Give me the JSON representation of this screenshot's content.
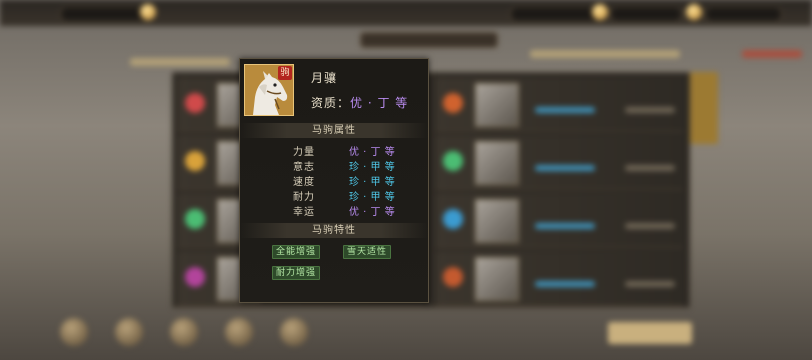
{
  "horse": {
    "badge": "驹",
    "name": "月骧",
    "aptitude_label": "资质：",
    "aptitude_value": "优 · 丁 等"
  },
  "sections": {
    "attributes_title": "马驹属性",
    "traits_title": "马驹特性"
  },
  "attributes": [
    {
      "name": "力量",
      "value": "优 · 丁 等",
      "grade": "you"
    },
    {
      "name": "意志",
      "value": "珍 · 甲 等",
      "grade": "zhen"
    },
    {
      "name": "速度",
      "value": "珍 · 甲 等",
      "grade": "zhen"
    },
    {
      "name": "耐力",
      "value": "珍 · 甲 等",
      "grade": "zhen"
    },
    {
      "name": "幸运",
      "value": "优 · 丁 等",
      "grade": "you"
    }
  ],
  "traits": [
    {
      "label": "全能增强"
    },
    {
      "label": "雪天适性"
    },
    {
      "label": "耐力增强"
    }
  ],
  "colors": {
    "grade_you": "#b98cf0",
    "grade_zhen": "#4fc7e8",
    "trait_text": "#b5e8a6",
    "badge_red": "#b3261e"
  },
  "icons": {
    "badge": "horse-badge",
    "portrait": "white-horse-portrait"
  }
}
